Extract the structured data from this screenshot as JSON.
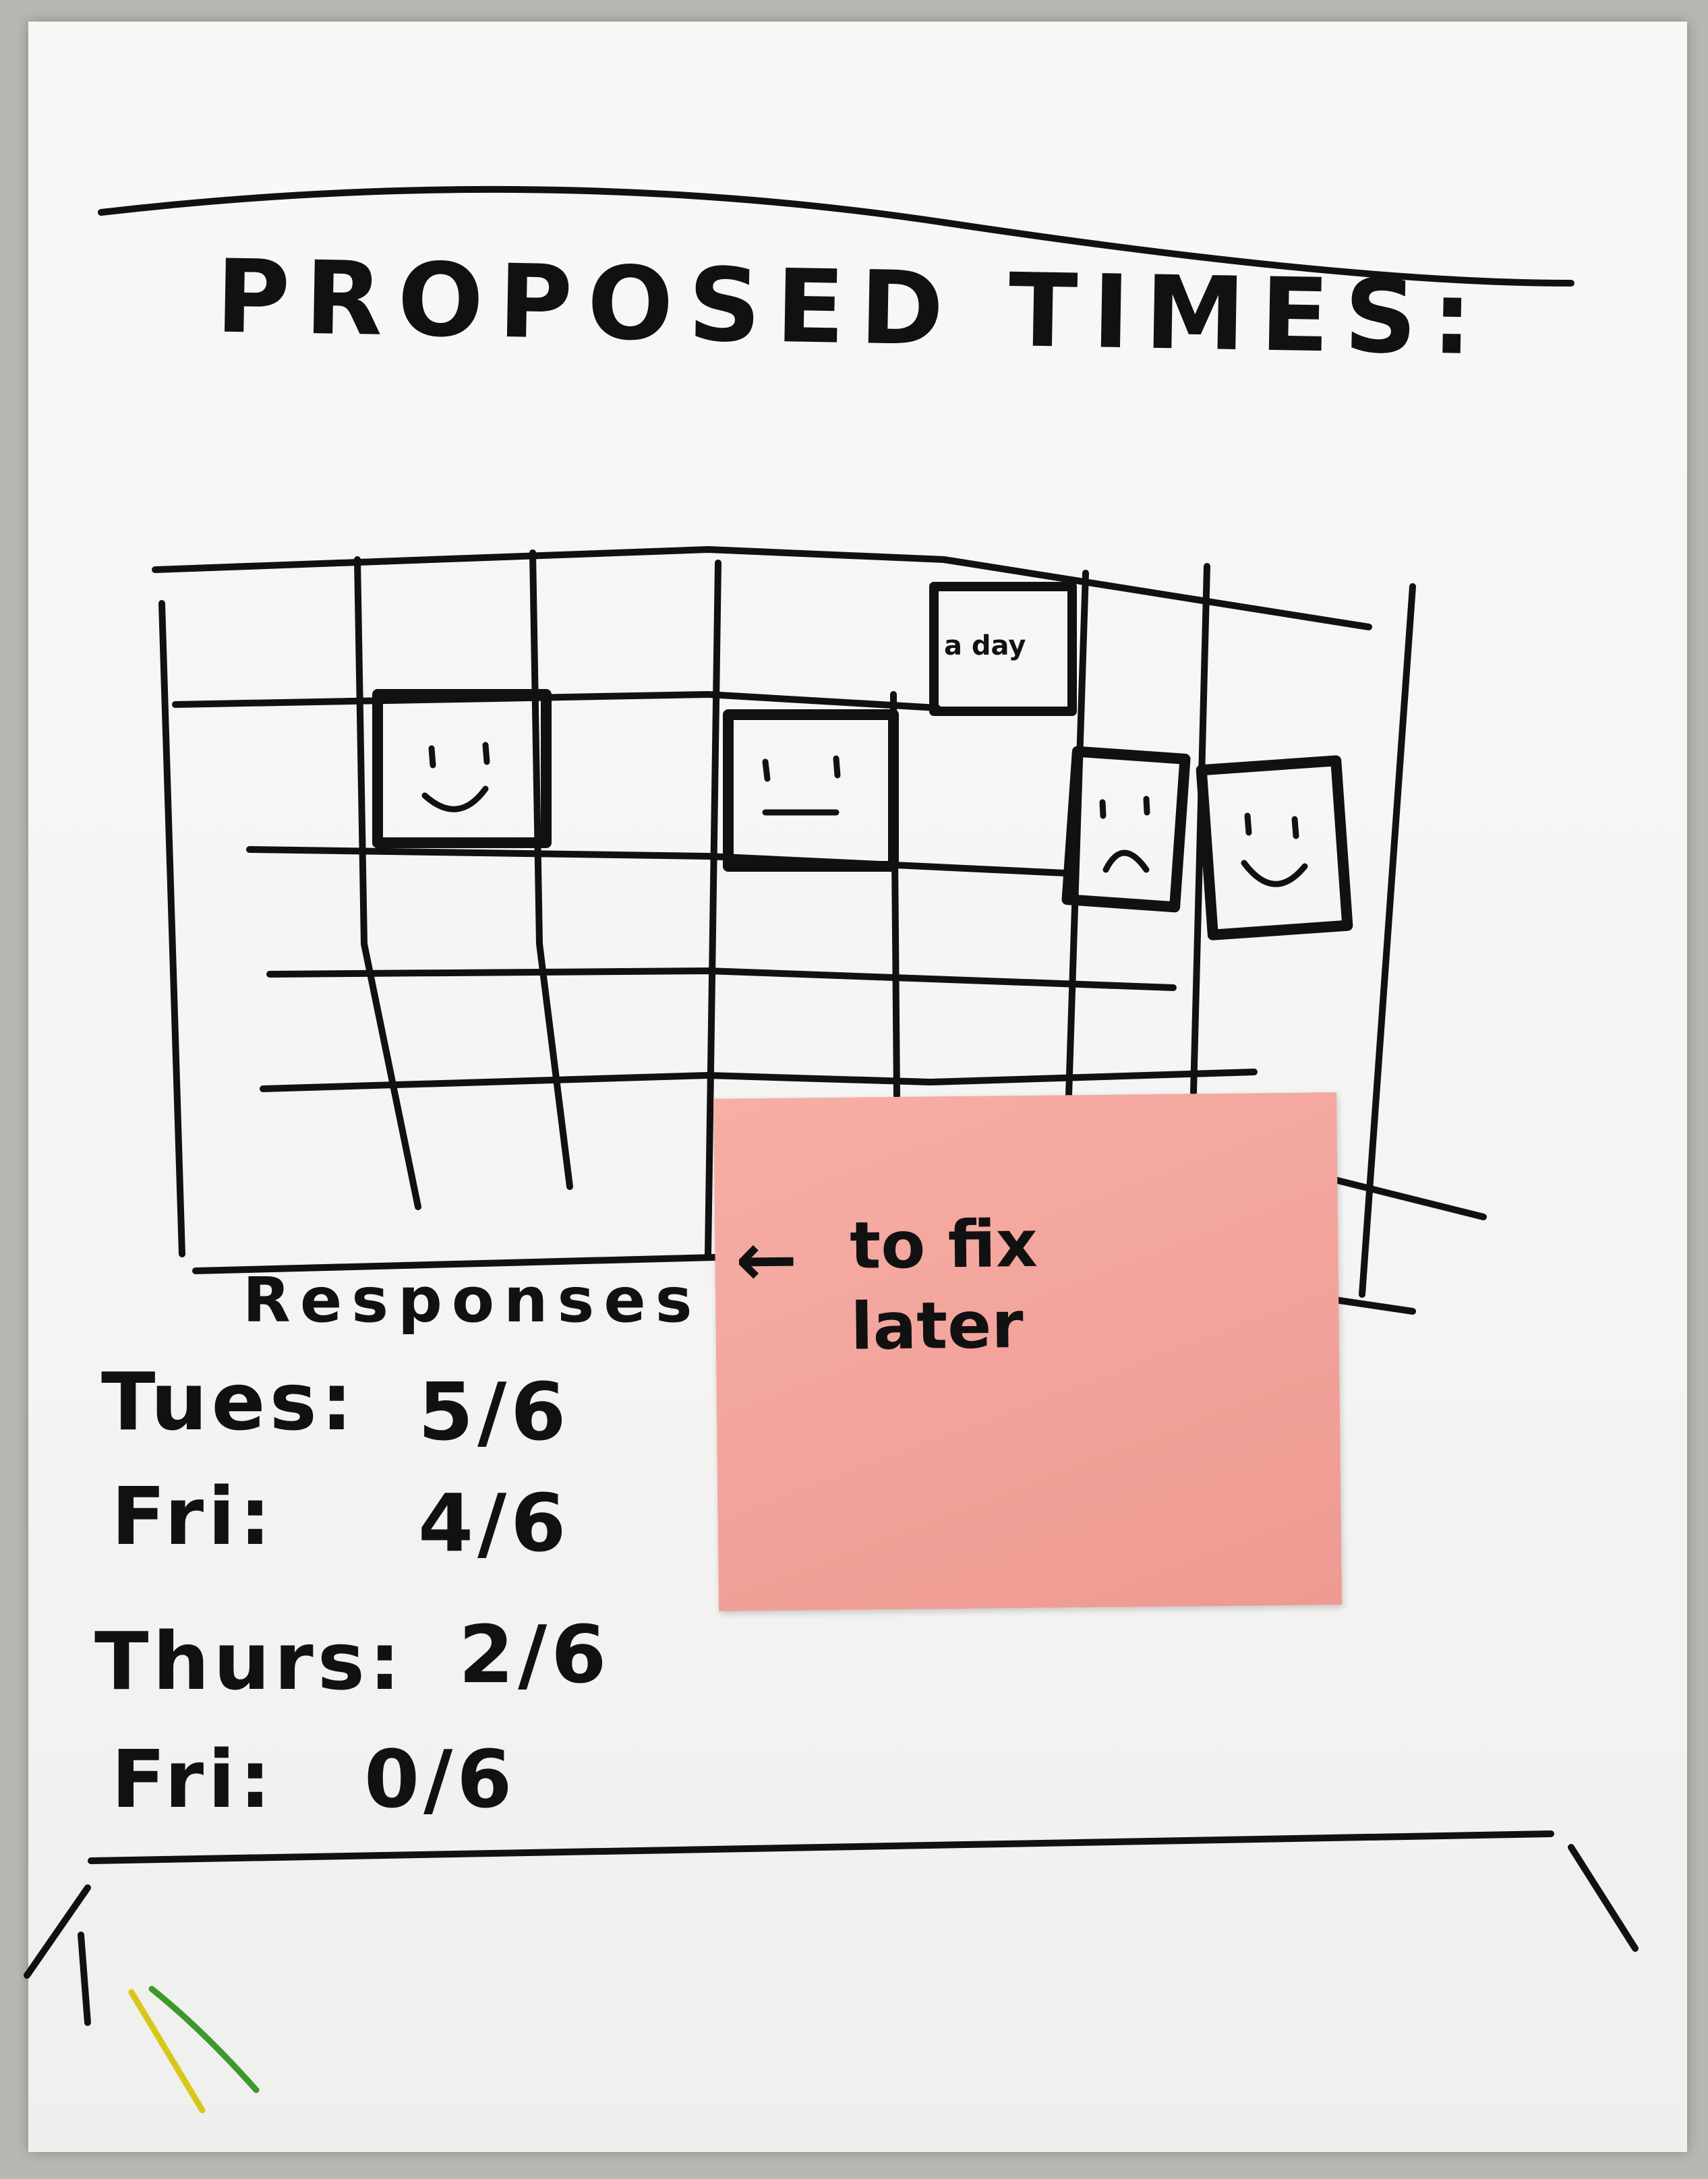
{
  "header": {
    "title": "PROPOSED TIMES:"
  },
  "calendar": {
    "busy_label": "a day"
  },
  "responses": {
    "label": "Responses",
    "rows": [
      {
        "day": "Tues:",
        "value": "5/6"
      },
      {
        "day": "Fri:",
        "value": "4/6"
      },
      {
        "day": "Thurs:",
        "value": "2/6"
      },
      {
        "day": "Fri:",
        "value": "0/6"
      }
    ]
  },
  "sticky_note": {
    "arrow": "←",
    "line1": "to fix",
    "line2": "later"
  },
  "colors": {
    "ink": "#111111",
    "paper": "#f6f6f4",
    "sticky": "#f3a59d",
    "marker_yellow": "#d8c71a",
    "marker_green": "#3b9a2a"
  }
}
